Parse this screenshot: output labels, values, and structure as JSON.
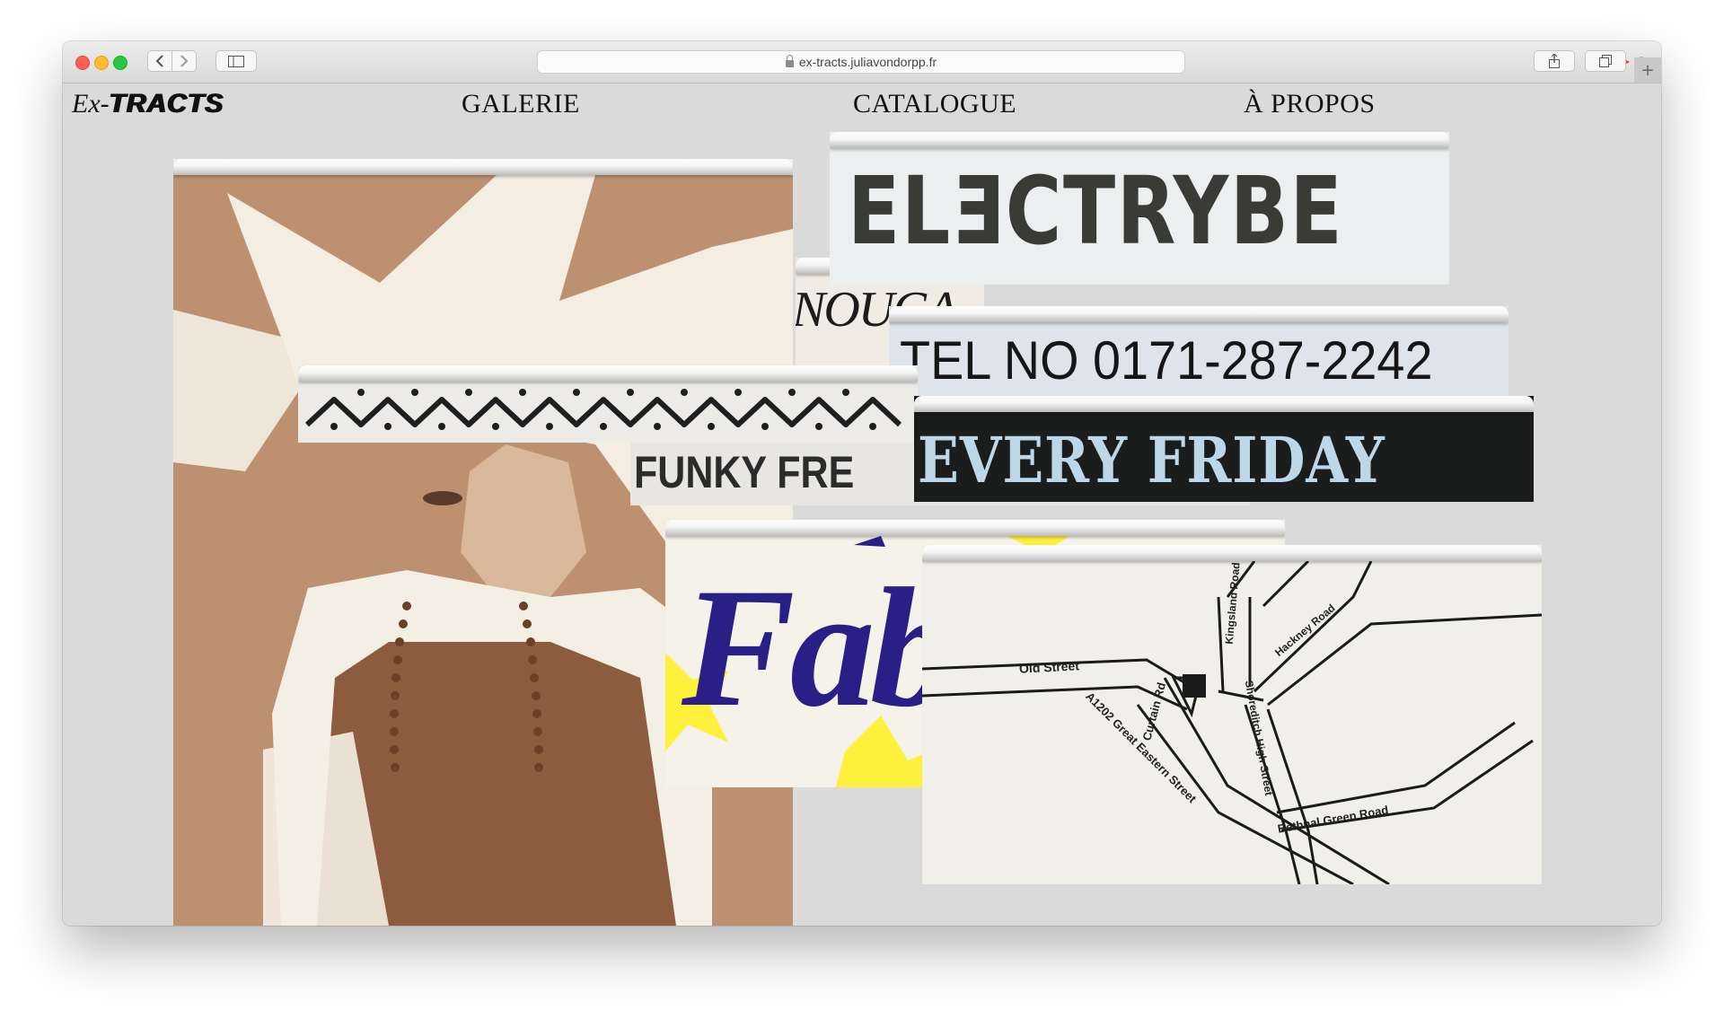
{
  "browser": {
    "url": "ex-tracts.juliavondorpp.fr",
    "back_icon": "chevron-left-icon",
    "forward_icon": "chevron-right-icon",
    "sidebar_icon": "sidebar-icon",
    "share_icon": "share-icon",
    "tabs_icon": "tabs-icon",
    "new_tab_label": "+"
  },
  "site": {
    "logo_part1": "Ex-",
    "logo_part2": "TRACTS",
    "nav": [
      "GALERIE",
      "CATALOGUE",
      "À PROPOS"
    ]
  },
  "clippings": {
    "electrybe": "ELƎCTRYBE",
    "nougat": "NOUGA",
    "tel": "TEL NO 0171-287-2242",
    "every_friday": "EVERY FRIDAY",
    "funky": "FUNKY FRE",
    "fab": "Fab",
    "map": {
      "old_street": "Old Street",
      "curtain_rd": "Curtain Rd",
      "great_eastern": "A1202 Great Eastern Street",
      "kingsland": "Kingsland Road",
      "hackney": "Hackney Road",
      "shoreditch": "Shoreditch High Street",
      "bethnal": "Bethnal Green Road"
    }
  },
  "colors": {
    "page_bg": "#dadada",
    "sepia": "#b08466",
    "navy": "#2a1f86",
    "yellow": "#fff03c",
    "friday_text": "#bcd8e8"
  }
}
